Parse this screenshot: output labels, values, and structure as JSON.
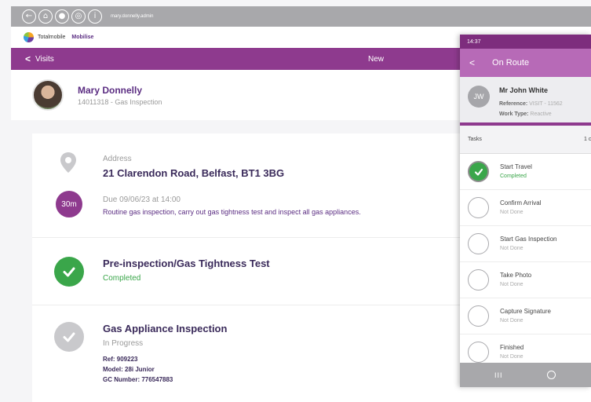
{
  "system_bar": {
    "username": "mary.donnelly.admin",
    "icons": [
      "back-circle-icon",
      "home-circle-icon",
      "user-circle-icon",
      "target-circle-icon",
      "info-circle-icon"
    ],
    "info_glyph": "i"
  },
  "brand": {
    "name": "Totalmobile",
    "product": "Mobilise"
  },
  "nav": {
    "back_label": "Visits",
    "back_glyph": "<",
    "center_label": "New"
  },
  "header": {
    "name": "Mary Donnelly",
    "subtitle": "14011318 - Gas Inspection"
  },
  "visit": {
    "address_label": "Address",
    "address": "21 Clarendon Road, Belfast, BT1 3BG",
    "duration_badge": "30m",
    "due": "Due 09/06/23 at 14:00",
    "description": "Routine gas inspection, carry out gas tightness test and inspect all gas appliances."
  },
  "sections": [
    {
      "title": "Pre-inspection/Gas Tightness Test",
      "status": "Completed"
    },
    {
      "title": "Gas Appliance Inspection",
      "status": "In Progress",
      "ref": "Ref: 909223",
      "model": "Model: 28i Junior",
      "gc_number": "GC Number: 776547883"
    }
  ],
  "phone": {
    "time": "14:37",
    "title": "On Route",
    "back_glyph": "<",
    "customer": {
      "initials": "JW",
      "name": "Mr John White",
      "reference_label": "Reference:",
      "reference": "VISIT - 11562",
      "work_type_label": "Work Type:",
      "work_type": "Reactive"
    },
    "tasks_label": "Tasks",
    "tasks_count": "1 c",
    "tasks": [
      {
        "title": "Start Travel",
        "status": "Completed"
      },
      {
        "title": "Confirm Arrival",
        "status": "Not Done"
      },
      {
        "title": "Start Gas Inspection",
        "status": "Not Done"
      },
      {
        "title": "Take Photo",
        "status": "Not Done"
      },
      {
        "title": "Capture Signature",
        "status": "Not Done"
      },
      {
        "title": "Finished",
        "status": "Not Done"
      }
    ],
    "bottom_menu_glyph": "III"
  },
  "colors": {
    "purple": "#8e3a8e",
    "green": "#3aa64a",
    "text_purple": "#5b2d82"
  }
}
